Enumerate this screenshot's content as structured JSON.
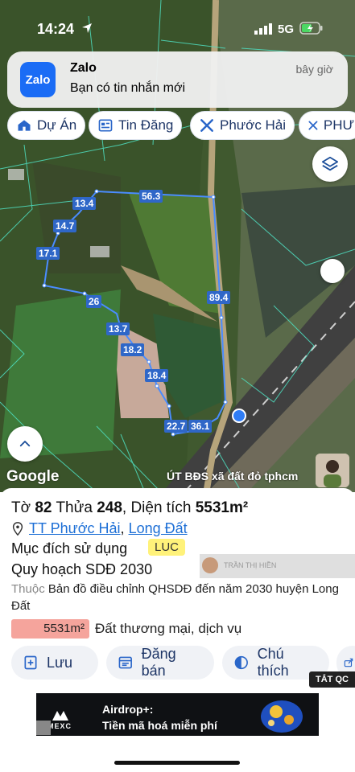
{
  "status_bar": {
    "time": "14:24",
    "network": "5G"
  },
  "notification": {
    "app_icon_text": "Zalo",
    "title": "Zalo",
    "message": "Bạn có tin nhắn mới",
    "time": "bây giờ"
  },
  "chips": [
    {
      "label": "Dự Án",
      "icon": "house-icon"
    },
    {
      "label": "Tin Đăng",
      "icon": "news-icon"
    },
    {
      "label": "Phước Hải",
      "icon": "tools-icon"
    },
    {
      "label": "PHƯ",
      "icon": "tools-icon"
    }
  ],
  "parcel_lengths": [
    "56.3",
    "13.4",
    "14.7",
    "17.1",
    "89.4",
    "26",
    "13.7",
    "18.2",
    "18.4",
    "22.7",
    "36.1"
  ],
  "map": {
    "attribution": "Google",
    "watermark": "ÚT BĐS xã đất đỏ tphcm"
  },
  "info": {
    "sheet_label": "Tờ",
    "sheet_no": "82",
    "parcel_label": "Thửa",
    "parcel_no": "248",
    "area_label": "Diện tích",
    "area": "5531m²",
    "ward": "TT Phước Hải",
    "district": "Long Đất",
    "purpose_label": "Mục đích sử dụng",
    "purpose_code": "LUC",
    "plan_title": "Quy hoạch SDĐ 2030",
    "source_label": "Thuộc",
    "source_text": "Bản đồ điều chỉnh QHSDĐ đến năm 2030 huyện Long Đất",
    "plan_area": "5531m²",
    "plan_use": "Đất thương mại, dịch vụ"
  },
  "overlay_name": "TRẦN THỊ HIỀN",
  "actions": [
    {
      "label": "Lưu",
      "icon": "save-icon"
    },
    {
      "label": "Đăng bán",
      "icon": "listing-icon"
    },
    {
      "label": "Chú thích",
      "icon": "legend-icon"
    }
  ],
  "close_ads_label": "TẮT QC",
  "ad": {
    "brand": "MEXC",
    "line1": "Airdrop+:",
    "line2": "Tiền mã hoá miễn phí"
  },
  "colors": {
    "accent": "#1d6fd6",
    "parcel_line": "#4a8cff",
    "badge": "#fff27a",
    "area_bar": "#f5a49c"
  }
}
